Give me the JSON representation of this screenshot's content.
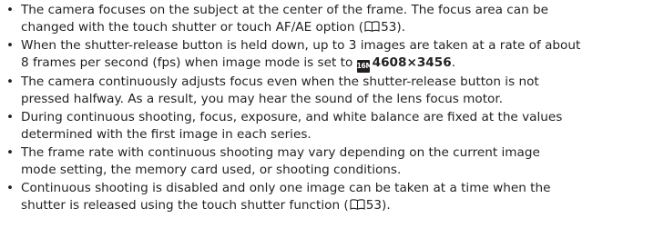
{
  "bullets": [
    {
      "line1": "The camera focuses on the subject at the center of the frame. The focus area can be",
      "line2_before": "changed with the touch shutter or touch AF/AE option (",
      "line2_ref": "53",
      "line2_after": ")."
    },
    {
      "line1": "When the shutter-release button is held down, up to 3 images are taken at a rate of about",
      "line2_before": "8 frames per second (fps) when image mode is set to ",
      "mode_icon": "image-mode-16m-icon",
      "mode_value": "4608×3456",
      "line2_after": "."
    },
    {
      "line1": "The camera continuously adjusts focus even when the shutter-release button is not",
      "line2": "pressed halfway. As a result, you may hear the sound of the lens focus motor."
    },
    {
      "line1": "During continuous shooting, focus, exposure, and white balance are fixed at the values",
      "line2": "determined with the first image in each series."
    },
    {
      "line1": "The frame rate with continuous shooting may vary depending on the current image",
      "line2": "mode setting, the memory card used, or shooting conditions."
    },
    {
      "line1": "Continuous shooting is disabled and only one image can be taken at a time when the",
      "line2_before": "shutter is released using the touch shutter function (",
      "line2_ref": "53",
      "line2_after": ")."
    }
  ],
  "bullet_char": "•",
  "text_color": "#231f20"
}
